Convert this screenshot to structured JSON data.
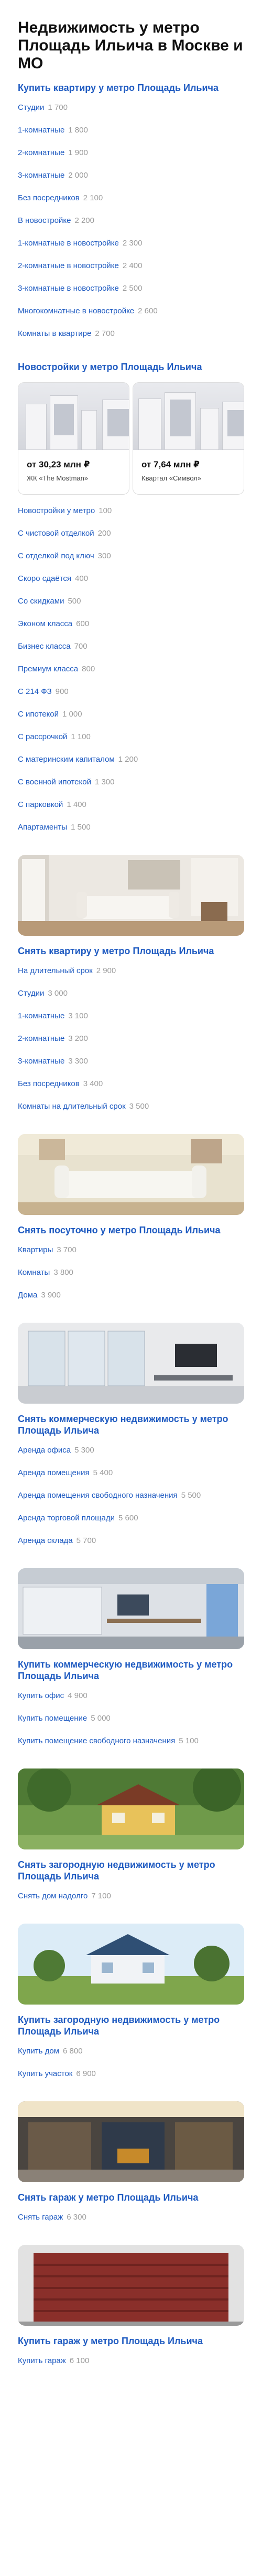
{
  "page_title": "Недвижимость у метро Площадь Ильича в Москве и МО",
  "buy_flat": {
    "title": "Купить квартиру у метро Площадь Ильича",
    "items": [
      {
        "label": "Студии",
        "count": "1 700"
      },
      {
        "label": "1-комнатные",
        "count": "1 800"
      },
      {
        "label": "2-комнатные",
        "count": "1 900"
      },
      {
        "label": "3-комнатные",
        "count": "2 000"
      },
      {
        "label": "Без посредников",
        "count": "2 100"
      },
      {
        "label": "В новостройке",
        "count": "2 200"
      },
      {
        "label": "1-комнатные в новостройке",
        "count": "2 300"
      },
      {
        "label": "2-комнатные в новостройке",
        "count": "2 400"
      },
      {
        "label": "3-комнатные в новостройке",
        "count": "2 500"
      },
      {
        "label": "Многокомнатные в новостройке",
        "count": "2 600"
      },
      {
        "label": "Комнаты в квартире",
        "count": "2 700"
      }
    ]
  },
  "new_buildings": {
    "title": "Новостройки у метро Площадь Ильича",
    "cards": [
      {
        "price": "от 30,23 млн ₽",
        "name": "ЖК «The Mostman»"
      },
      {
        "price": "от 7,64 млн ₽",
        "name": "Квартал «Символ»"
      }
    ],
    "items": [
      {
        "label": "Новостройки у метро",
        "count": "100"
      },
      {
        "label": "С чистовой отделкой",
        "count": "200"
      },
      {
        "label": "С отделкой под ключ",
        "count": "300"
      },
      {
        "label": "Скоро сдаётся",
        "count": "400"
      },
      {
        "label": "Со скидками",
        "count": "500"
      },
      {
        "label": "Эконом класса",
        "count": "600"
      },
      {
        "label": "Бизнес класса",
        "count": "700"
      },
      {
        "label": "Премиум класса",
        "count": "800"
      },
      {
        "label": "С 214 ФЗ",
        "count": "900"
      },
      {
        "label": "С ипотекой",
        "count": "1 000"
      },
      {
        "label": "С рассрочкой",
        "count": "1 100"
      },
      {
        "label": "С материнским капиталом",
        "count": "1 200"
      },
      {
        "label": "С военной ипотекой",
        "count": "1 300"
      },
      {
        "label": "С парковкой",
        "count": "1 400"
      },
      {
        "label": "Апартаменты",
        "count": "1 500"
      }
    ]
  },
  "rent_flat": {
    "title": "Снять квартиру у метро Площадь Ильича",
    "items": [
      {
        "label": "На длительный срок",
        "count": "2 900"
      },
      {
        "label": "Студии",
        "count": "3 000"
      },
      {
        "label": "1-комнатные",
        "count": "3 100"
      },
      {
        "label": "2-комнатные",
        "count": "3 200"
      },
      {
        "label": "3-комнатные",
        "count": "3 300"
      },
      {
        "label": "Без посредников",
        "count": "3 400"
      },
      {
        "label": "Комнаты на длительный срок",
        "count": "3 500"
      }
    ]
  },
  "rent_daily": {
    "title": "Снять посуточно у метро Площадь Ильича",
    "items": [
      {
        "label": "Квартиры",
        "count": "3 700"
      },
      {
        "label": "Комнаты",
        "count": "3 800"
      },
      {
        "label": "Дома",
        "count": "3 900"
      }
    ]
  },
  "rent_commercial": {
    "title": "Снять коммерческую недвижимость у метро Площадь Ильича",
    "items": [
      {
        "label": "Аренда офиса",
        "count": "5 300"
      },
      {
        "label": "Аренда помещения",
        "count": "5 400"
      },
      {
        "label": "Аренда помещения свободного назначения",
        "count": "5 500"
      },
      {
        "label": "Аренда торговой площади",
        "count": "5 600"
      },
      {
        "label": "Аренда склада",
        "count": "5 700"
      }
    ]
  },
  "buy_commercial": {
    "title": "Купить коммерческую недвижимость у метро Площадь Ильича",
    "items": [
      {
        "label": "Купить офис",
        "count": "4 900"
      },
      {
        "label": "Купить помещение",
        "count": "5 000"
      },
      {
        "label": "Купить помещение свободного назначения",
        "count": "5 100"
      }
    ]
  },
  "rent_country": {
    "title": "Снять загородную недвижимость у метро Площадь Ильича",
    "items": [
      {
        "label": "Снять дом надолго",
        "count": "7 100"
      }
    ]
  },
  "buy_country": {
    "title": "Купить загородную недвижимость у метро Площадь Ильича",
    "items": [
      {
        "label": "Купить дом",
        "count": "6 800"
      },
      {
        "label": "Купить участок",
        "count": "6 900"
      }
    ]
  },
  "rent_garage": {
    "title": "Снять гараж у метро Площадь Ильича",
    "items": [
      {
        "label": "Снять гараж",
        "count": "6 300"
      }
    ]
  },
  "buy_garage": {
    "title": "Купить гараж у метро Площадь Ильича",
    "items": [
      {
        "label": "Купить гараж",
        "count": "6 100"
      }
    ]
  },
  "colors": {
    "link": "#1f5bc1",
    "count": "#9b9b9b",
    "title": "#111111"
  }
}
